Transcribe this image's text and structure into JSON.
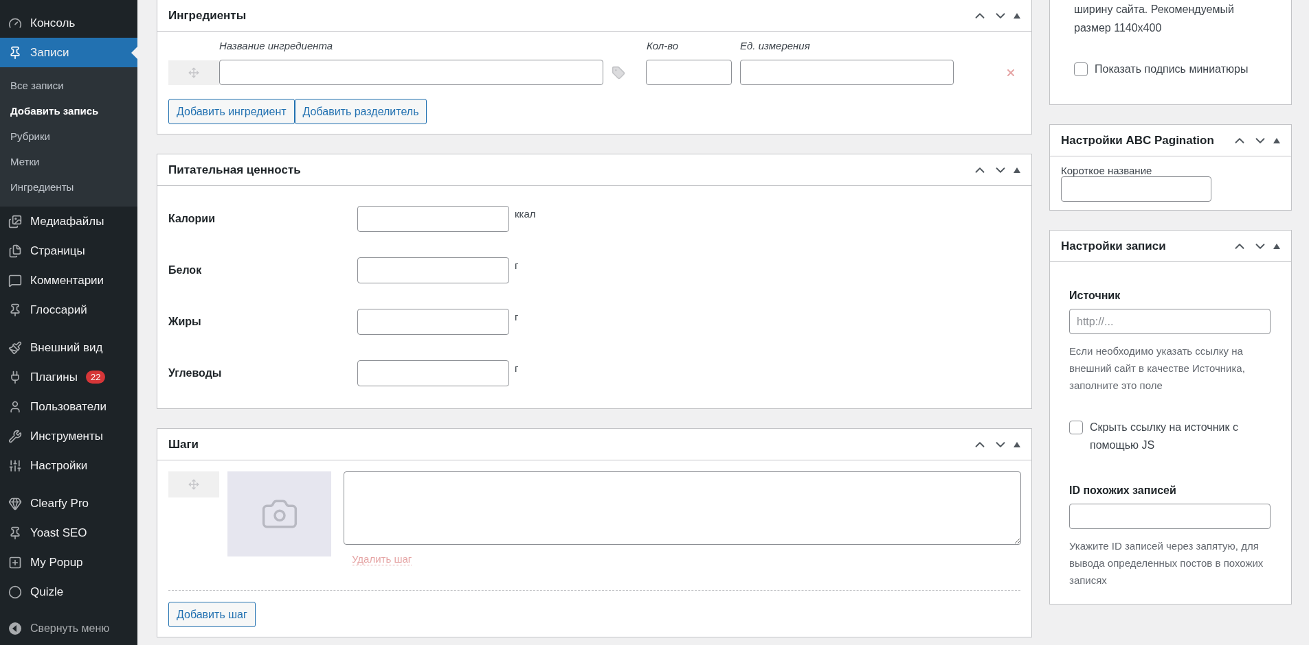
{
  "sidebar": {
    "groups": [
      [
        {
          "label": "Консоль",
          "selected": false
        },
        {
          "label": "Записи",
          "selected": true,
          "children": [
            {
              "label": "Все записи",
              "selected": false
            },
            {
              "label": "Добавить запись",
              "selected": true
            },
            {
              "label": "Рубрики",
              "selected": false
            },
            {
              "label": "Метки",
              "selected": false
            },
            {
              "label": "Ингредиенты",
              "selected": false
            }
          ]
        },
        {
          "label": "Медиафайлы",
          "selected": false
        },
        {
          "label": "Страницы",
          "selected": false
        },
        {
          "label": "Комментарии",
          "selected": false
        },
        {
          "label": "Глоссарий",
          "selected": false
        }
      ],
      [
        {
          "label": "Внешний вид",
          "selected": false
        },
        {
          "label": "Плагины",
          "selected": false,
          "badge": "22"
        },
        {
          "label": "Пользователи",
          "selected": false
        },
        {
          "label": "Инструменты",
          "selected": false
        },
        {
          "label": "Настройки",
          "selected": false
        }
      ],
      [
        {
          "label": "Clearfy Pro",
          "selected": false
        },
        {
          "label": "Yoast SEO",
          "selected": false
        },
        {
          "label": "My Popup",
          "selected": false
        },
        {
          "label": "Quizle",
          "selected": false
        }
      ]
    ],
    "collapse": "Свернуть меню"
  },
  "ingredients_panel": {
    "title": "Ингредиенты",
    "columns": [
      "Название ингредиента",
      "Кол-во",
      "Ед. измерения"
    ],
    "buttons": [
      "Добавить ингредиент",
      "Добавить разделитель"
    ]
  },
  "nutrition_panel": {
    "title": "Питательная ценность",
    "rows": [
      {
        "label": "Калории",
        "unit": "ккал"
      },
      {
        "label": "Белок",
        "unit": "г"
      },
      {
        "label": "Жиры",
        "unit": "г"
      },
      {
        "label": "Углеводы",
        "unit": "г"
      }
    ]
  },
  "steps_panel": {
    "title": "Шаги",
    "delete_link": "Удалить шаг",
    "add_button": "Добавить шаг"
  },
  "thumbnail_panel": {
    "text": "ширину сайта. Рекомендуемый размер 1140x400",
    "checkbox": {
      "label": "Показать подпись миниатюры",
      "checked": false
    }
  },
  "abc_panel": {
    "title": "Настройки ABC Pagination",
    "field_label": "Короткое название"
  },
  "post_settings_panel": {
    "title": "Настройки записи",
    "source_label": "Источник",
    "source_placeholder": "http://...",
    "source_help": "Если необходимо указать ссылку на внешний сайт в качестве Источника, заполните это поле",
    "hide_checkbox": {
      "label": "Скрыть ссылку на источник с помощью JS",
      "checked": false
    },
    "similar_label": "ID похожих записей",
    "similar_help": "Укажите ID записей через запятую, для вывода определенных постов в похожих записях"
  }
}
